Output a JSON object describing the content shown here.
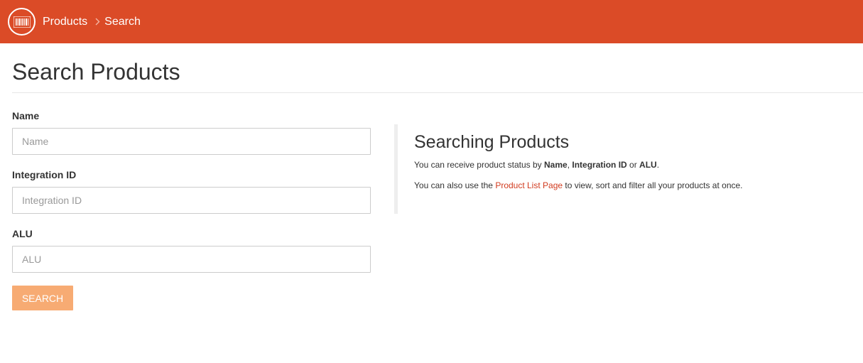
{
  "colors": {
    "brand": "#db4b27",
    "button": "#f7ab73",
    "link": "#d13b1f"
  },
  "header": {
    "logo_icon": "barcode-icon",
    "breadcrumb": {
      "parent_label": "Products",
      "separator_icon": "chevron-right-icon",
      "current_label": "Search"
    }
  },
  "page": {
    "title": "Search Products"
  },
  "form": {
    "name": {
      "label": "Name",
      "value": "",
      "placeholder": "Name"
    },
    "integration_id": {
      "label": "Integration ID",
      "value": "",
      "placeholder": "Integration ID"
    },
    "alu": {
      "label": "ALU",
      "value": "",
      "placeholder": "ALU"
    },
    "search_button_label": "SEARCH"
  },
  "help": {
    "title": "Searching Products",
    "p1": {
      "prefix": "You can receive product status by ",
      "term1": "Name",
      "sep1": ", ",
      "term2": "Integration ID",
      "sep2": " or ",
      "term3": "ALU",
      "suffix": "."
    },
    "p2": {
      "prefix": "You can also use the ",
      "link_label": "Product List Page",
      "suffix": " to view, sort and filter all your products at once."
    }
  }
}
